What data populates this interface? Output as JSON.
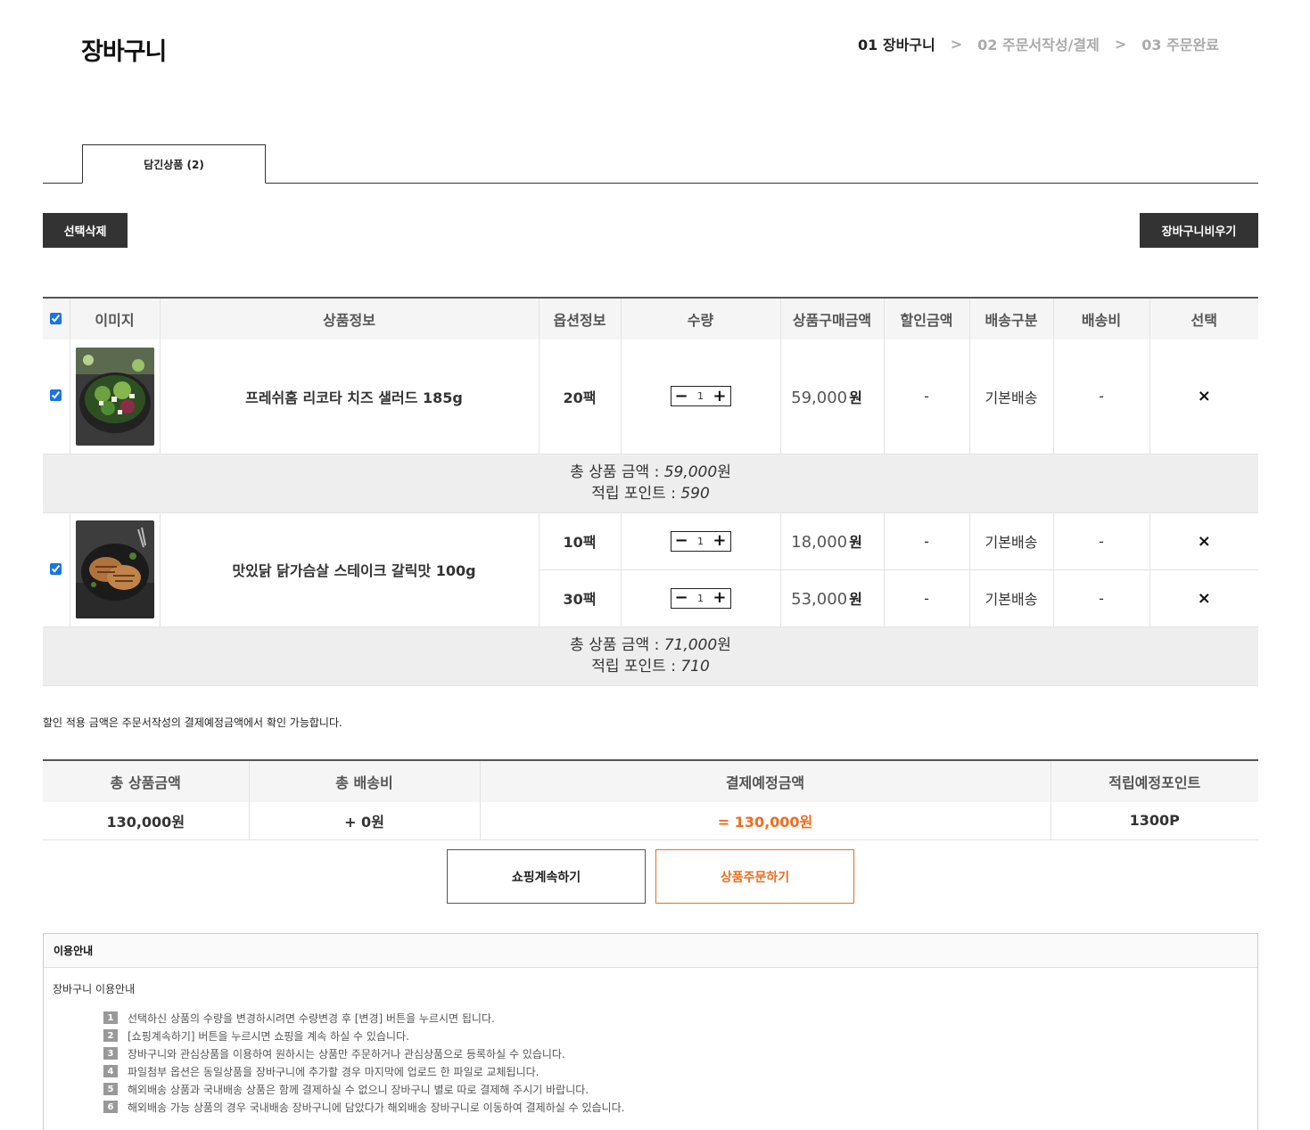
{
  "header": {
    "title": "장바구니",
    "steps": [
      {
        "label": "01 장바구니"
      },
      {
        "label": "02 주문서작성/결제"
      },
      {
        "label": "03 주문완료"
      }
    ],
    "step_separator": ">"
  },
  "tab": {
    "label": "담긴상품 (2)"
  },
  "actions": {
    "delete_selected": "선택삭제",
    "empty_cart": "장바구니비우기"
  },
  "cart": {
    "columns": [
      "이미지",
      "상품정보",
      "옵션정보",
      "수량",
      "상품구매금액",
      "할인금액",
      "배송구분",
      "배송비",
      "선택"
    ],
    "remove_icon": "×",
    "groups": [
      {
        "name": "프레쉬홈 리코타 치즈 샐러드 185g",
        "image": "salad-photo",
        "options": [
          {
            "option": "20팩",
            "qty": "1",
            "price": "59,000",
            "currency": "원",
            "discount": "-",
            "delivery_type": "기본배송",
            "delivery_fee": "-"
          }
        ],
        "summary": {
          "total_label": "총 상품 금액 : ",
          "total_value": "59,000",
          "total_unit": "원",
          "points_label": "적립 포인트 : ",
          "points_value": "590"
        }
      },
      {
        "name": "맛있닭 닭가슴살 스테이크 갈릭맛 100g",
        "image": "chicken-steak-photo",
        "options": [
          {
            "option": "10팩",
            "qty": "1",
            "price": "18,000",
            "currency": "원",
            "discount": "-",
            "delivery_type": "기본배송",
            "delivery_fee": "-"
          },
          {
            "option": "30팩",
            "qty": "1",
            "price": "53,000",
            "currency": "원",
            "discount": "-",
            "delivery_type": "기본배송",
            "delivery_fee": "-"
          }
        ],
        "summary": {
          "total_label": "총 상품 금액 : ",
          "total_value": "71,000",
          "total_unit": "원",
          "points_label": "적립 포인트 : ",
          "points_value": "710"
        }
      }
    ]
  },
  "notice": "할인 적용 금액은 주문서작성의 결제예정금액에서 확인 가능합니다.",
  "totals": {
    "headers": [
      "총 상품금액",
      "총 배송비",
      "결제예정금액",
      "적립예정포인트"
    ],
    "product_total": "130,000원",
    "shipping_total": "+ 0원",
    "payment_total": "= 130,000원",
    "points_total": "1300P",
    "accent_color": "#ef6d1e"
  },
  "buttons": {
    "continue_shopping": "쇼핑계속하기",
    "order": "상품주문하기"
  },
  "guide": {
    "title": "이용안내",
    "subtitle": "장바구니 이용안내",
    "items": [
      {
        "n": "1",
        "text": "선택하신 상품의 수량을 변경하시려면 수량변경 후 [변경] 버튼을 누르시면 됩니다."
      },
      {
        "n": "2",
        "text": "[쇼핑계속하기] 버튼을 누르시면 쇼핑을 계속 하실 수 있습니다."
      },
      {
        "n": "3",
        "text": "장바구니와 관심상품을 이용하여 원하시는 상품만 주문하거나 관심상품으로 등록하실 수 있습니다."
      },
      {
        "n": "4",
        "text": "파일첨부 옵션은 동일상품을 장바구니에 추가할 경우 마지막에 업로드 한 파일로 교체됩니다."
      },
      {
        "n": "5",
        "text": "해외배송 상품과 국내배송 상품은 함께 결제하실 수 없으니 장바구니 별로 따로 결제해 주시기 바랍니다."
      },
      {
        "n": "6",
        "text": "해외배송 가능 상품의 경우 국내배송 장바구니에 담았다가 해외배송 장바구니로 이동하여 결제하실 수 있습니다."
      }
    ]
  }
}
